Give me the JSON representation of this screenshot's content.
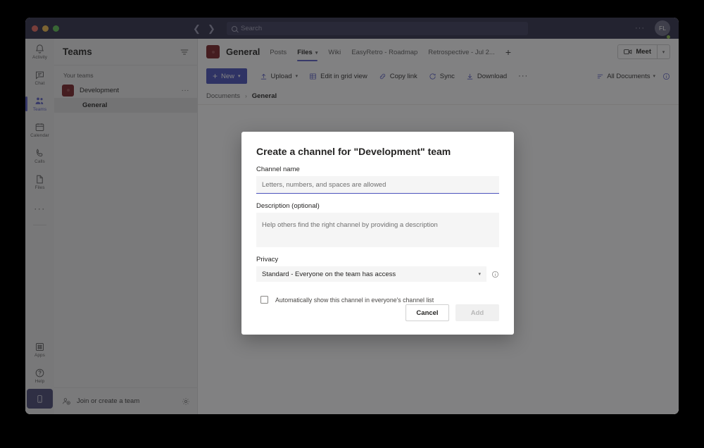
{
  "titlebar": {
    "search_placeholder": "Search",
    "back_icon": "chevron-left-icon",
    "forward_icon": "chevron-right-icon",
    "ellipsis": "···",
    "avatar_initials": "FL"
  },
  "rail": {
    "items": [
      {
        "label": "Activity",
        "icon": "bell-icon",
        "active": false
      },
      {
        "label": "Chat",
        "icon": "chat-icon",
        "active": false
      },
      {
        "label": "Teams",
        "icon": "people-icon",
        "active": true
      },
      {
        "label": "Calendar",
        "icon": "calendar-icon",
        "active": false
      },
      {
        "label": "Calls",
        "icon": "phone-icon",
        "active": false
      },
      {
        "label": "Files",
        "icon": "file-icon",
        "active": false
      }
    ],
    "more_icon": "ellipsis-icon",
    "more_label": "···",
    "bottom_items": [
      {
        "label": "Apps",
        "icon": "apps-icon"
      },
      {
        "label": "Help",
        "icon": "help-icon"
      }
    ],
    "mobile_icon": "mobile-phone-icon"
  },
  "teams_panel": {
    "title": "Teams",
    "filter_icon": "filter-icon",
    "section_label": "Your teams",
    "team": {
      "name": "Development",
      "more_icon": "···"
    },
    "channel": {
      "name": "General"
    },
    "footer": {
      "label": "Join or create a team",
      "icon": "add-people-icon",
      "settings_icon": "gear-icon"
    }
  },
  "channel_header": {
    "title": "General",
    "tabs": [
      {
        "label": "Posts",
        "active": false,
        "has_caret": false
      },
      {
        "label": "Files",
        "active": true,
        "has_caret": true
      },
      {
        "label": "Wiki",
        "active": false,
        "has_caret": false
      },
      {
        "label": "EasyRetro - Roadmap",
        "active": false,
        "has_caret": false
      },
      {
        "label": "Retrospective - Jul 2...",
        "active": false,
        "has_caret": false
      }
    ],
    "add_tab_icon": "plus-icon",
    "meet_label": "Meet",
    "meet_icon": "camera-icon",
    "meet_caret_icon": "chevron-down-icon"
  },
  "command_bar": {
    "new_label": "New",
    "new_icon": "plus-icon",
    "new_caret": "chevron-down-icon",
    "items": [
      {
        "label": "Upload",
        "icon": "upload-icon",
        "has_caret": true
      },
      {
        "label": "Edit in grid view",
        "icon": "grid-icon",
        "has_caret": false
      },
      {
        "label": "Copy link",
        "icon": "link-icon",
        "has_caret": false
      },
      {
        "label": "Sync",
        "icon": "sync-icon",
        "has_caret": false
      },
      {
        "label": "Download",
        "icon": "download-icon",
        "has_caret": false
      }
    ],
    "overflow": "···",
    "view_label": "All Documents",
    "view_icon": "list-view-icon",
    "view_caret": "chevron-down-icon",
    "info_icon": "info-circle-icon"
  },
  "breadcrumb": {
    "root": "Documents",
    "separator": "›",
    "current": "General"
  },
  "modal": {
    "title": "Create a channel for \"Development\" team",
    "channel_name_label": "Channel name",
    "channel_name_value": "",
    "channel_name_placeholder": "Letters, numbers, and spaces are allowed",
    "description_label": "Description (optional)",
    "description_value": "",
    "description_placeholder": "Help others find the right channel by providing a description",
    "privacy_label": "Privacy",
    "privacy_value": "Standard - Everyone on the team has access",
    "privacy_caret": "chevron-down-icon",
    "privacy_info_icon": "info-circle-icon",
    "checkbox_label": "Automatically show this channel in everyone's channel list",
    "checkbox_checked": false,
    "cancel_label": "Cancel",
    "add_label": "Add"
  },
  "colors": {
    "accent": "#5b5fc7",
    "primary_button": "#4b53bc",
    "titlebar": "#2f2f4a",
    "team_avatar": "#7a2226",
    "presence_online": "#92c353"
  }
}
